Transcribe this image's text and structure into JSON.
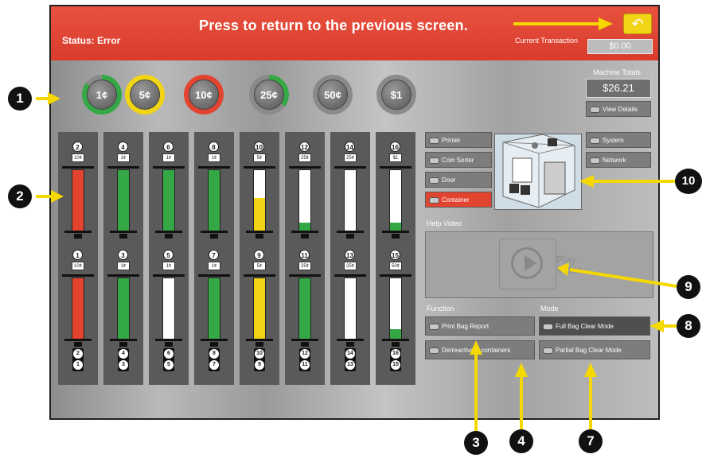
{
  "header": {
    "status": "Status: Error",
    "instruction": "Press to return to the previous screen.",
    "back_icon": "return-arrow-icon",
    "current_transaction_label": "Current Transaction",
    "current_transaction_value": "$0.00"
  },
  "coins": [
    {
      "label": "1¢",
      "ring_color": "#34a844",
      "fill_fraction": 0.85
    },
    {
      "label": "5¢",
      "ring_color": "#f2d416",
      "fill_fraction": 1.0
    },
    {
      "label": "10¢",
      "ring_color": "#e3442f",
      "fill_fraction": 1.0
    },
    {
      "label": "25¢",
      "ring_color": "#34a844",
      "fill_fraction": 0.35
    },
    {
      "label": "50¢",
      "ring_color": "#8a8a8a",
      "fill_fraction": 0.0
    },
    {
      "label": "$1",
      "ring_color": "#8a8a8a",
      "fill_fraction": 0.0
    }
  ],
  "machine_totals": {
    "label": "Machine Totals",
    "value": "$26.21",
    "view_details": "View Details"
  },
  "containers": [
    {
      "top_num": "2",
      "top_den": "10¢",
      "top_fill": 1.0,
      "top_color": "#e3442f",
      "bot_num": "1",
      "bot_den": "10¢",
      "bot_fill": 1.0,
      "bot_color": "#e3442f",
      "stack_top": "2",
      "stack_bot": "1"
    },
    {
      "top_num": "4",
      "top_den": "1¢",
      "top_fill": 1.0,
      "top_color": "#34a844",
      "bot_num": "3",
      "bot_den": "1¢",
      "bot_fill": 1.0,
      "bot_color": "#34a844",
      "stack_top": "4",
      "stack_bot": "3"
    },
    {
      "top_num": "6",
      "top_den": "1¢",
      "top_fill": 1.0,
      "top_color": "#34a844",
      "bot_num": "5",
      "bot_den": "1¢",
      "bot_fill": 0.0,
      "bot_color": "#34a844",
      "stack_top": "6",
      "stack_bot": "5"
    },
    {
      "top_num": "8",
      "top_den": "1¢",
      "top_fill": 1.0,
      "top_color": "#34a844",
      "bot_num": "7",
      "bot_den": "1¢",
      "bot_fill": 1.0,
      "bot_color": "#34a844",
      "stack_top": "8",
      "stack_bot": "7"
    },
    {
      "top_num": "10",
      "top_den": "5¢",
      "top_fill": 0.55,
      "top_color": "#f2d416",
      "bot_num": "9",
      "bot_den": "5¢",
      "bot_fill": 1.0,
      "bot_color": "#f2d416",
      "stack_top": "10",
      "stack_bot": "9"
    },
    {
      "top_num": "12",
      "top_den": "25¢",
      "top_fill": 0.15,
      "top_color": "#34a844",
      "bot_num": "11",
      "bot_den": "25¢",
      "bot_fill": 1.0,
      "bot_color": "#34a844",
      "stack_top": "12",
      "stack_bot": "11"
    },
    {
      "top_num": "14",
      "top_den": "25¢",
      "top_fill": 0.0,
      "top_color": "#34a844",
      "bot_num": "13",
      "bot_den": "25¢",
      "bot_fill": 0.0,
      "bot_color": "#34a844",
      "stack_top": "14",
      "stack_bot": "13"
    },
    {
      "top_num": "16",
      "top_den": "$1",
      "top_fill": 0.15,
      "top_color": "#34a844",
      "bot_num": "15",
      "bot_den": "50¢",
      "bot_fill": 0.18,
      "bot_color": "#34a844",
      "stack_top": "16",
      "stack_bot": "15"
    }
  ],
  "components": {
    "printer": "Printer",
    "coin_sorter": "Coin Sorter",
    "door": "Door",
    "container": "Container",
    "system": "System",
    "network": "Network"
  },
  "help_video": {
    "label": "Help Video",
    "play_line1": "Play",
    "play_line2": "Video"
  },
  "function": {
    "label": "Function",
    "print_bag_report": "Print Bag Report",
    "de_reactivate": "De/reactivate containers"
  },
  "mode": {
    "label": "Mode",
    "full_bag": "Full Bag Clear Mode",
    "partial_bag": "Partial Bag Clear Mode"
  },
  "callouts": {
    "c1": "1",
    "c2": "2",
    "c3": "3",
    "c4": "4",
    "c7": "7",
    "c8": "8",
    "c9": "9",
    "c10": "10"
  },
  "colors": {
    "accent": "#e3442f",
    "callout_arrow": "#f5d800"
  }
}
